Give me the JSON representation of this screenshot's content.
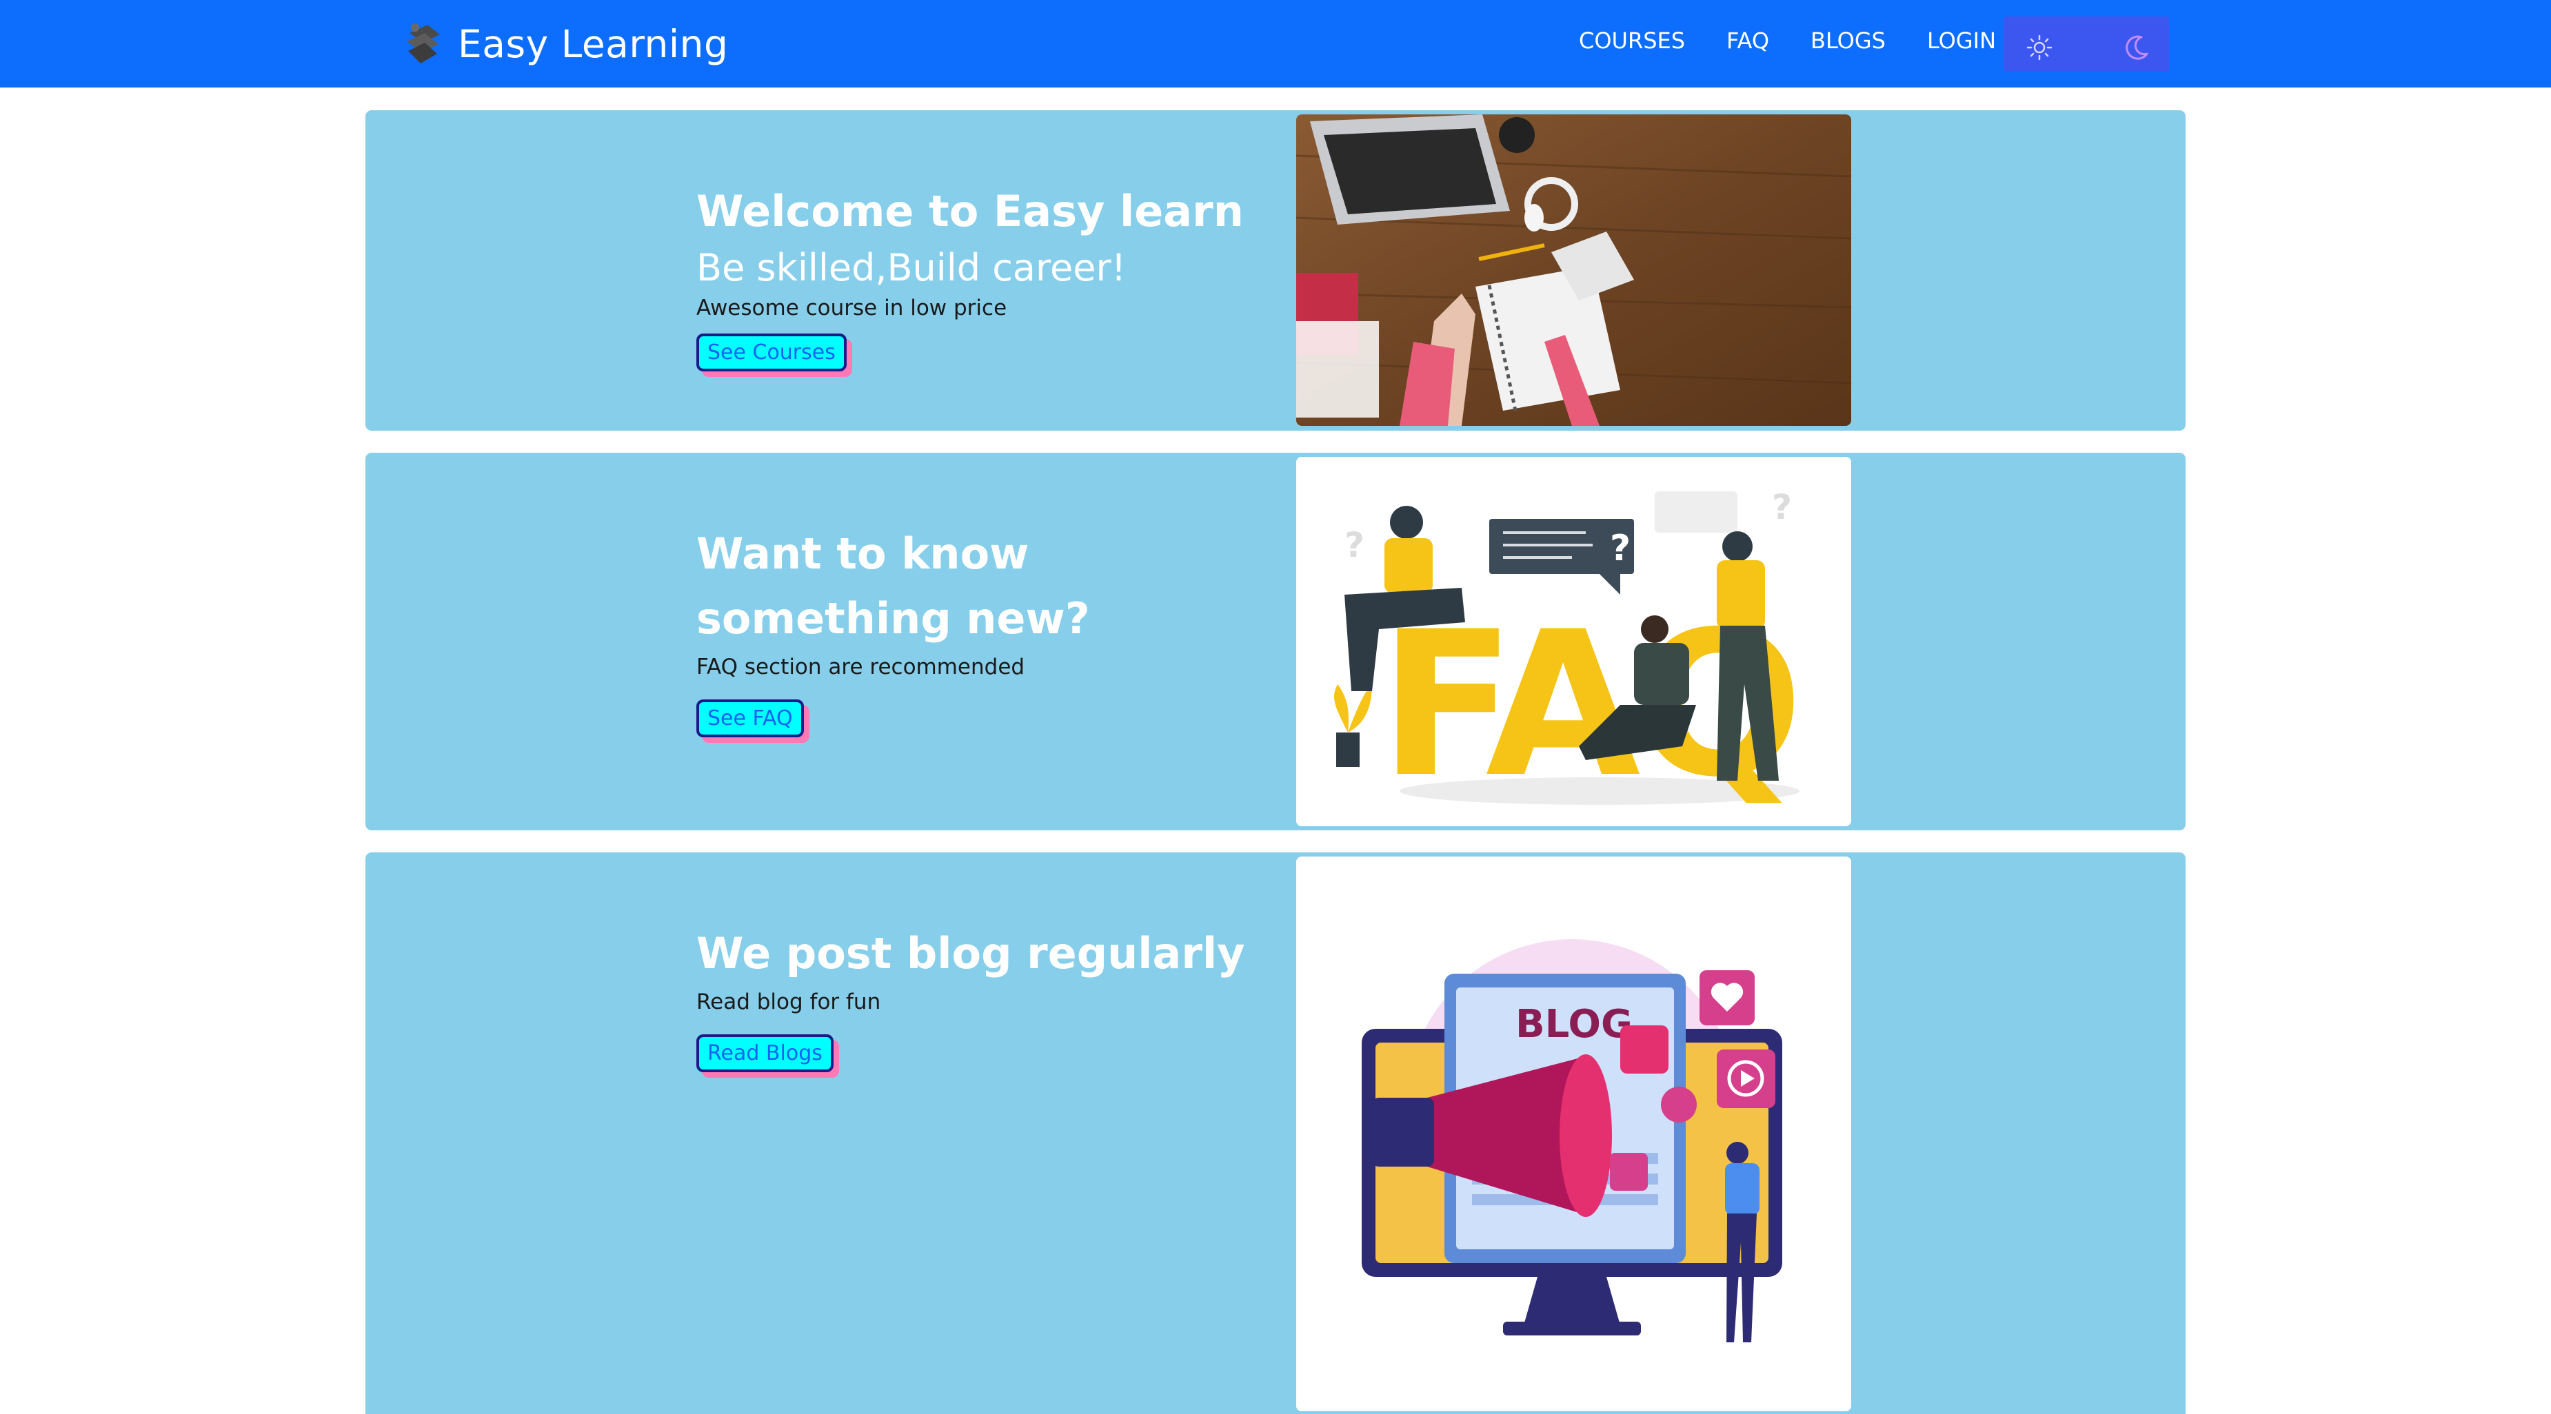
{
  "navbar": {
    "brand": "Easy Learning",
    "links": [
      "COURSES",
      "FAQ",
      "BLOGS",
      "LOGIN"
    ],
    "theme_icons": [
      "sun-icon",
      "moon-icon"
    ]
  },
  "hero": {
    "title": "Welcome to Easy learn",
    "subtitle": "Be skilled,Build career!",
    "description": "Awesome course in low price",
    "button": "See Courses"
  },
  "faq": {
    "title": "Want to know something new?",
    "description": "FAQ section are recommended",
    "button": "See FAQ",
    "illustration_text": "FAQ"
  },
  "blog": {
    "title": "We post blog regularly",
    "description": "Read blog for fun",
    "button": "Read Blogs",
    "illustration_text": "BLOG"
  },
  "colors": {
    "navbar": "#0d6efd",
    "section_bg": "#87ceeb",
    "button_bg": "#00ffff",
    "button_shadow": "#ff79b4"
  }
}
